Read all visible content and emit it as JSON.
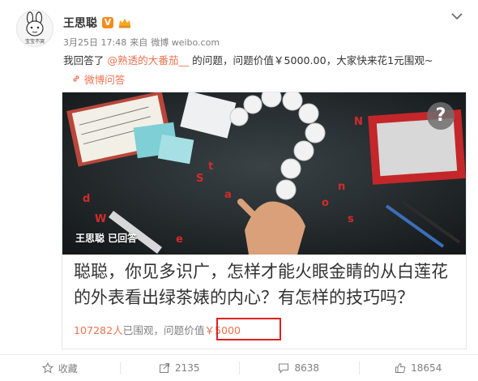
{
  "user": {
    "name": "王思聪",
    "verified_badge": "V",
    "avatar_text": "宝宝不哭",
    "avatar_icon": "bunny-avatar-icon",
    "level_icon": "crown-badge-icon"
  },
  "meta": {
    "date": "3月25日 17:48",
    "source_prefix": "来自",
    "source": "微博 weibo.com"
  },
  "post": {
    "text_before": "我回答了",
    "mention": "@熟透的大番茄__",
    "text_after": "的问题，问题价值￥5000.00，大家快来花1元围观~"
  },
  "qa_link": {
    "label": "微博问答",
    "icon": "link-icon"
  },
  "qa_card": {
    "answered_by": "王思聪 已回答",
    "badge": "?",
    "question": "聪聪，你见多识广，怎样才能火眼金睛的从白莲花的外表看出绿茶婊的内心？有怎样的技巧吗？",
    "viewers": "107282人",
    "viewers_suffix": "已围观，问题价值",
    "price": "￥5000"
  },
  "actions": [
    {
      "label": "收藏",
      "icon": "star-icon"
    },
    {
      "label": "2135",
      "icon": "share-icon"
    },
    {
      "label": "8638",
      "icon": "comment-icon"
    },
    {
      "label": "18654",
      "icon": "like-icon"
    }
  ],
  "colors": {
    "accent": "#eb7350",
    "highlight_box": "#e02020",
    "verified": "#f58c1b"
  }
}
